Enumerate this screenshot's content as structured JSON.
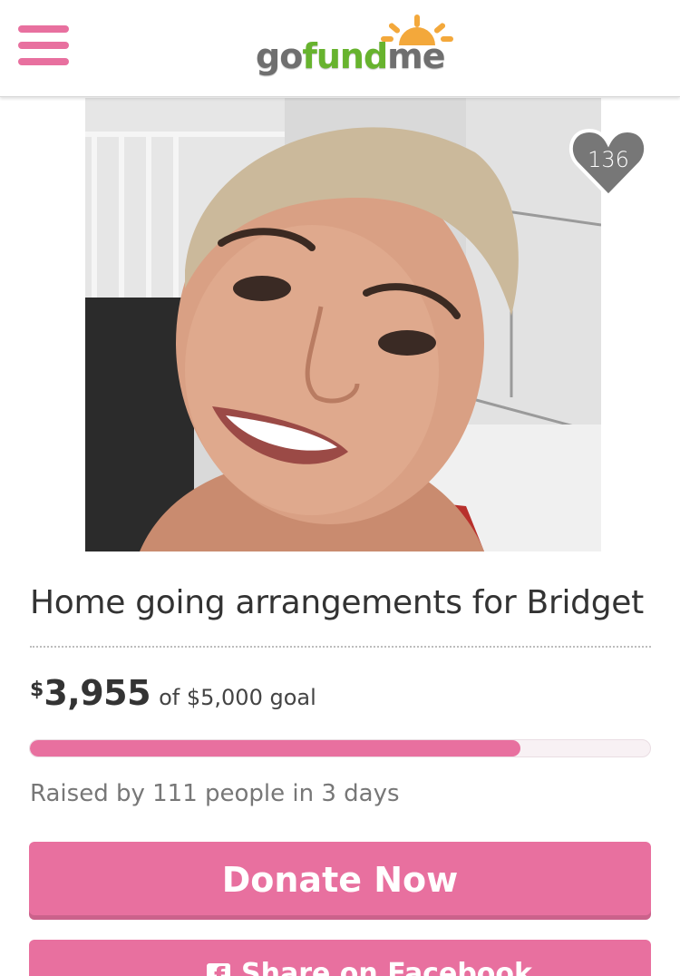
{
  "brand": {
    "logo_text_go": "go",
    "logo_text_fund": "fund",
    "logo_text_me": "me",
    "color_pink": "#e8709f",
    "color_green": "#67b32e",
    "color_grey": "#6f6f6f",
    "color_orange": "#f3a83b"
  },
  "header": {
    "menu_icon": "hamburger-menu-icon"
  },
  "campaign": {
    "heart_count": "136",
    "title": "Home going arrangements for Bridget",
    "currency_symbol": "$",
    "raised_amount": "3,955",
    "goal_text": "of $5,000 goal",
    "progress_fraction": 0.791,
    "raised_by_text": "Raised by 111 people in 3 days"
  },
  "actions": {
    "donate_label": "Donate Now",
    "share_label": "Share on Facebook",
    "share_icon": "facebook-icon"
  }
}
